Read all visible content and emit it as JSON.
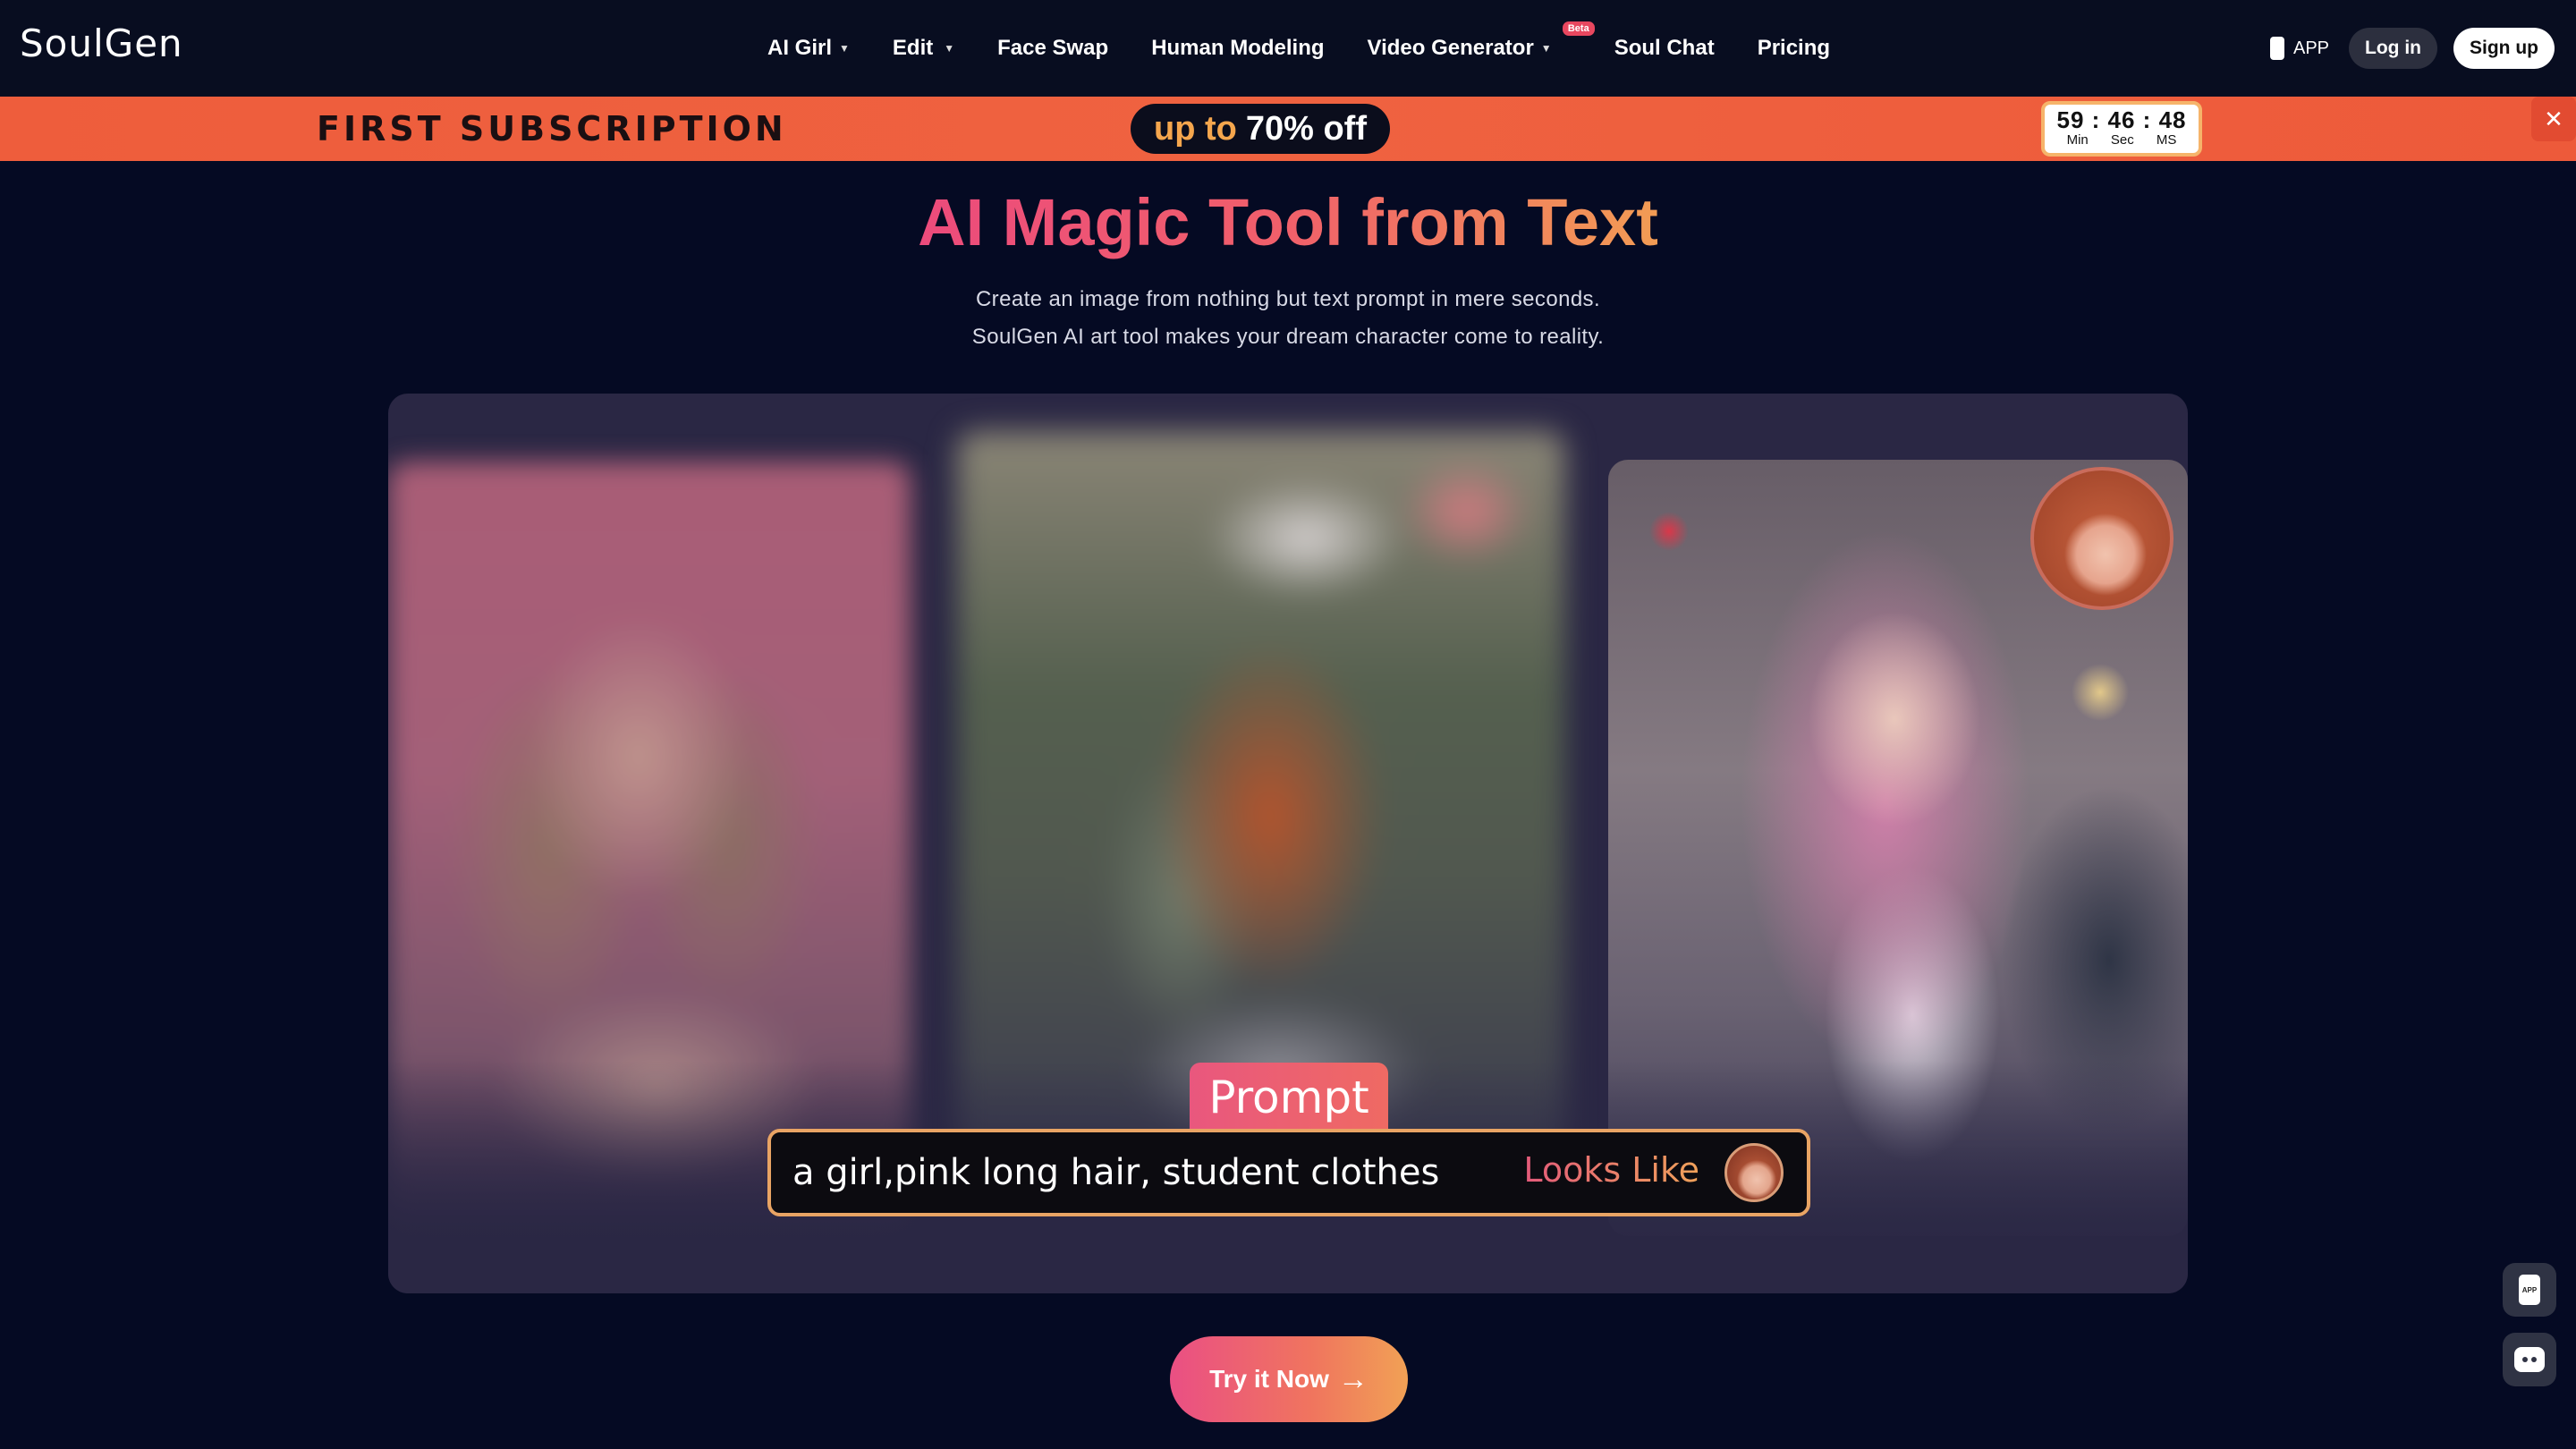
{
  "header": {
    "logo": "SoulGen",
    "nav": [
      {
        "label": "AI Girl",
        "has_dropdown": true
      },
      {
        "label": "Edit",
        "has_dropdown": true
      },
      {
        "label": "Face Swap",
        "has_dropdown": false
      },
      {
        "label": "Human Modeling",
        "has_dropdown": false
      },
      {
        "label": "Video Generator",
        "has_dropdown": true,
        "badge": "Beta"
      },
      {
        "label": "Soul Chat",
        "has_dropdown": false
      },
      {
        "label": "Pricing",
        "has_dropdown": false
      }
    ],
    "app_label": "APP",
    "login_label": "Log in",
    "signup_label": "Sign up"
  },
  "promo": {
    "title": "FIRST SUBSCRIPTION",
    "upto": "up to",
    "discount": "70% off",
    "timer": {
      "min": "59",
      "sec": "46",
      "ms": "48",
      "min_label": "Min",
      "sec_label": "Sec",
      "ms_label": "MS"
    },
    "close_icon": "close-icon"
  },
  "hero": {
    "title": "AI Magic Tool from Text",
    "subtitle_line1": "Create an image from nothing but text prompt in mere seconds.",
    "subtitle_line2": "SoulGen AI art tool makes your dream character come to reality."
  },
  "showcase": {
    "prompt_tab": "Prompt",
    "prompt_text": "a girl,pink long hair, student clothes",
    "looks_like": "Looks Like"
  },
  "cta": {
    "label": "Try it Now",
    "icon": "arrow-right-icon"
  },
  "floating": {
    "app_badge": "APP",
    "chat_icon": "chat-bot-icon"
  },
  "colors": {
    "background": "#050a23",
    "promo_bar": "#ee5d3c",
    "accent_pink": "#ea4f84",
    "accent_orange": "#f1a155"
  }
}
